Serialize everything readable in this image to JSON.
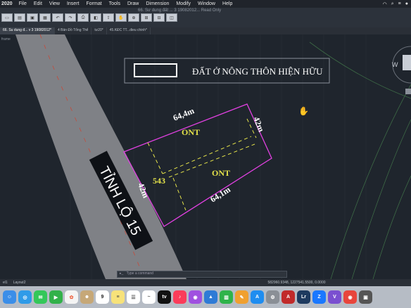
{
  "menubar": {
    "app": "2020",
    "items": [
      "File",
      "Edit",
      "View",
      "Insert",
      "Format",
      "Tools",
      "Draw",
      "Dimension",
      "Modify",
      "Window",
      "Help"
    ],
    "right_icons": [
      "wifi-icon",
      "search-icon",
      "control-center-icon",
      "siri-icon"
    ]
  },
  "window": {
    "title": "66. Sư dung đất ... 3 19082012... Read Only"
  },
  "tabs": [
    {
      "label": "66. Su dung đ... v 3 19082012*",
      "active": true
    },
    {
      "label": "4 Bản Đồ Tổng Thể",
      "active": false
    },
    {
      "label": "tư20*",
      "active": false
    },
    {
      "label": "45.KĐC TT...dieu chinh*",
      "active": false
    }
  ],
  "viewport": {
    "label": "frame"
  },
  "drawing": {
    "legend_text": "ĐẤT Ở NÔNG THÔN HIỆN HỮU",
    "road_label": "TỈNH LỘ 15",
    "dims": {
      "top": "64,4m",
      "right": "42m",
      "bottom": "64,1m",
      "left": "42m"
    },
    "zones": [
      "ONT",
      "ONT"
    ],
    "lot_number": "543",
    "compass": "W"
  },
  "command": {
    "placeholder": "Type a command"
  },
  "status": {
    "coords": "582960.9348, 1227541.5500, 0.0000",
    "layout_tabs": [
      "el1",
      "Layout2"
    ]
  },
  "dock": {
    "apps": [
      "Finder",
      "Safari",
      "Messages",
      "FaceTime",
      "Photos",
      "Contacts",
      "Calendar",
      "Notes",
      "Reminders",
      "Freeform",
      "Apple TV",
      "Music",
      "Podcasts",
      "Keynote",
      "Numbers",
      "Pages",
      "App Store",
      "System Settings",
      "AutoCAD",
      "LrC",
      "Zalo",
      "Viber",
      "Chrome",
      "Photo Viewer"
    ],
    "calendar_day": "9"
  }
}
